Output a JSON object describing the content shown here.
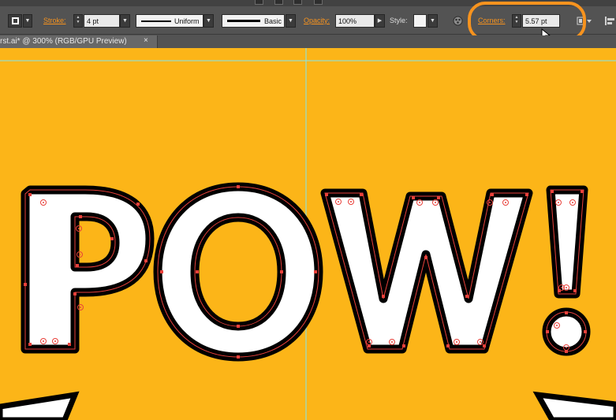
{
  "control_bar": {
    "stroke_label": "Stroke:",
    "stroke_weight": "4 pt",
    "variable_width_profile": "Uniform",
    "brush_definition": "Basic",
    "opacity_label": "Opacity:",
    "opacity_value": "100%",
    "style_label": "Style:",
    "corners_label": "Corners:",
    "corners_value": "5.57 pt"
  },
  "document_tab": {
    "title": "rst.ai* @ 300% (RGB/GPU Preview)",
    "close_glyph": "×"
  },
  "artwork": {
    "text": "POW!",
    "fill_color": "#ffffff",
    "outline_color": "#000000",
    "path_color": "#e8413b",
    "background_color": "#fcb518"
  },
  "colors": {
    "highlight": "#f7931e",
    "guide": "#7fe6f0"
  }
}
